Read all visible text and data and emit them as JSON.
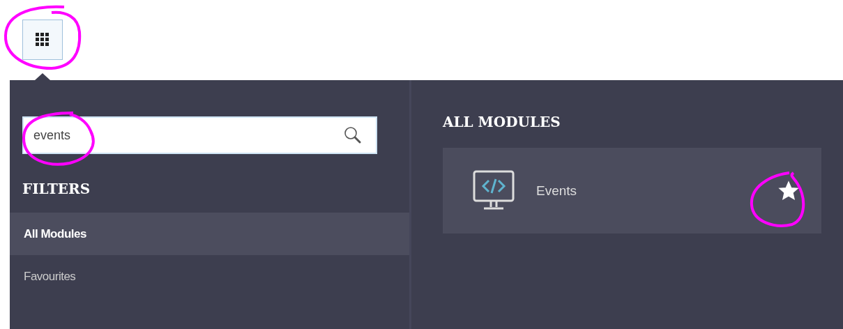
{
  "search": {
    "value": "events"
  },
  "filters": {
    "title": "FILTERS",
    "items": [
      {
        "label": "All Modules",
        "selected": true
      },
      {
        "label": "Favourites",
        "selected": false
      }
    ]
  },
  "modules": {
    "title": "ALL MODULES",
    "items": [
      {
        "label": "Events",
        "favourite": true
      }
    ]
  }
}
